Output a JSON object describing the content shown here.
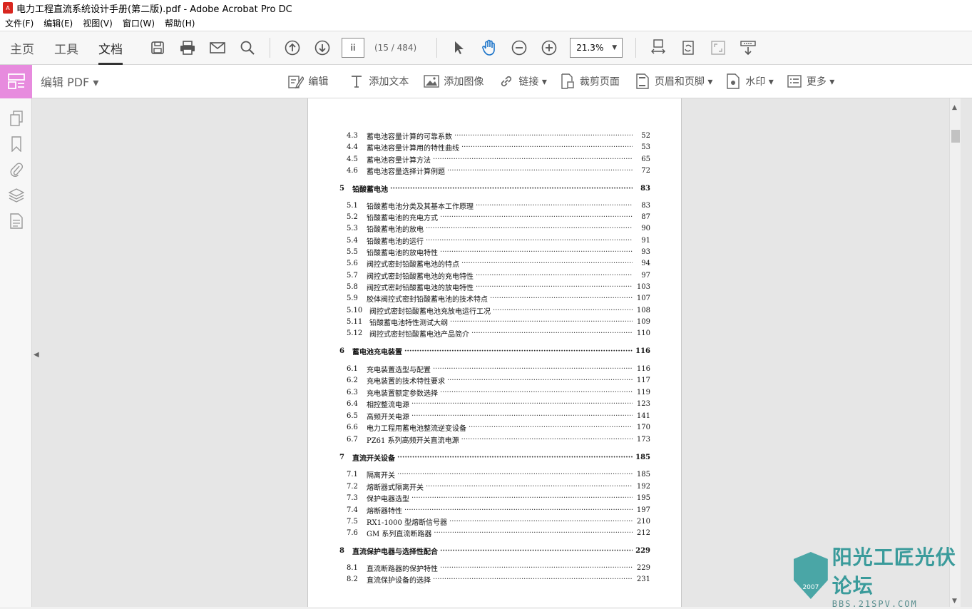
{
  "window": {
    "title": "电力工程直流系统设计手册(第二版).pdf - Adobe Acrobat Pro DC"
  },
  "menu": [
    "文件(F)",
    "编辑(E)",
    "视图(V)",
    "窗口(W)",
    "帮助(H)"
  ],
  "tabs": [
    "主页",
    "工具",
    "文档"
  ],
  "toolbar": {
    "page_value": "ii",
    "page_count": "(15 / 484)",
    "zoom": "21.3%"
  },
  "editbar": {
    "label": "编辑 PDF ▾",
    "tools": [
      "编辑",
      "添加文本",
      "添加图像",
      "链接 ▾",
      "裁剪页面",
      "页眉和页脚 ▾",
      "水印 ▾",
      "更多 ▾"
    ]
  },
  "toc": [
    {
      "num": "4.3",
      "title": "蓄电池容量计算的可靠系数",
      "page": "52",
      "chapter": false
    },
    {
      "num": "4.4",
      "title": "蓄电池容量计算用的特性曲线",
      "page": "53",
      "chapter": false
    },
    {
      "num": "4.5",
      "title": "蓄电池容量计算方法",
      "page": "65",
      "chapter": false
    },
    {
      "num": "4.6",
      "title": "蓄电池容量选择计算例题",
      "page": "72",
      "chapter": false
    },
    {
      "num": "5",
      "title": "铅酸蓄电池",
      "page": "83",
      "chapter": true
    },
    {
      "num": "5.1",
      "title": "铅酸蓄电池分类及其基本工作原理",
      "page": "83",
      "chapter": false
    },
    {
      "num": "5.2",
      "title": "铅酸蓄电池的充电方式",
      "page": "87",
      "chapter": false
    },
    {
      "num": "5.3",
      "title": "铅酸蓄电池的放电",
      "page": "90",
      "chapter": false
    },
    {
      "num": "5.4",
      "title": "铅酸蓄电池的运行",
      "page": "91",
      "chapter": false
    },
    {
      "num": "5.5",
      "title": "铅酸蓄电池的放电特性",
      "page": "93",
      "chapter": false
    },
    {
      "num": "5.6",
      "title": "阀控式密封铅酸蓄电池的特点",
      "page": "94",
      "chapter": false
    },
    {
      "num": "5.7",
      "title": "阀控式密封铅酸蓄电池的充电特性",
      "page": "97",
      "chapter": false
    },
    {
      "num": "5.8",
      "title": "阀控式密封铅酸蓄电池的放电特性",
      "page": "103",
      "chapter": false
    },
    {
      "num": "5.9",
      "title": "胶体阀控式密封铅酸蓄电池的技术特点",
      "page": "107",
      "chapter": false
    },
    {
      "num": "5.10",
      "title": "阀控式密封铅酸蓄电池充放电运行工况",
      "page": "108",
      "chapter": false
    },
    {
      "num": "5.11",
      "title": "铅酸蓄电池特性测试大纲",
      "page": "109",
      "chapter": false
    },
    {
      "num": "5.12",
      "title": "阀控式密封铅酸蓄电池产品简介",
      "page": "110",
      "chapter": false
    },
    {
      "num": "6",
      "title": "蓄电池充电装置",
      "page": "116",
      "chapter": true
    },
    {
      "num": "6.1",
      "title": "充电装置选型与配置",
      "page": "116",
      "chapter": false
    },
    {
      "num": "6.2",
      "title": "充电装置的技术特性要求",
      "page": "117",
      "chapter": false
    },
    {
      "num": "6.3",
      "title": "充电装置额定参数选择",
      "page": "119",
      "chapter": false
    },
    {
      "num": "6.4",
      "title": "相控整流电源",
      "page": "123",
      "chapter": false
    },
    {
      "num": "6.5",
      "title": "高频开关电源",
      "page": "141",
      "chapter": false
    },
    {
      "num": "6.6",
      "title": "电力工程用蓄电池整流逆变设备",
      "page": "170",
      "chapter": false
    },
    {
      "num": "6.7",
      "title": "PZ61 系列高频开关直流电源",
      "page": "173",
      "chapter": false
    },
    {
      "num": "7",
      "title": "直流开关设备",
      "page": "185",
      "chapter": true
    },
    {
      "num": "7.1",
      "title": "隔离开关",
      "page": "185",
      "chapter": false
    },
    {
      "num": "7.2",
      "title": "熔断器式隔离开关",
      "page": "192",
      "chapter": false
    },
    {
      "num": "7.3",
      "title": "保护电器选型",
      "page": "195",
      "chapter": false
    },
    {
      "num": "7.4",
      "title": "熔断器特性",
      "page": "197",
      "chapter": false
    },
    {
      "num": "7.5",
      "title": "RX1-1000 型熔断信号器",
      "page": "210",
      "chapter": false
    },
    {
      "num": "7.6",
      "title": "GM 系列直流断路器",
      "page": "212",
      "chapter": false
    },
    {
      "num": "8",
      "title": "直流保护电器与选择性配合",
      "page": "229",
      "chapter": true
    },
    {
      "num": "8.1",
      "title": "直流断路器的保护特性",
      "page": "229",
      "chapter": false
    },
    {
      "num": "8.2",
      "title": "直流保护设备的选择",
      "page": "231",
      "chapter": false
    }
  ],
  "watermark": {
    "main": "阳光工匠光伏论坛",
    "sub": "BBS.21SPV.COM",
    "seal": "2007"
  }
}
